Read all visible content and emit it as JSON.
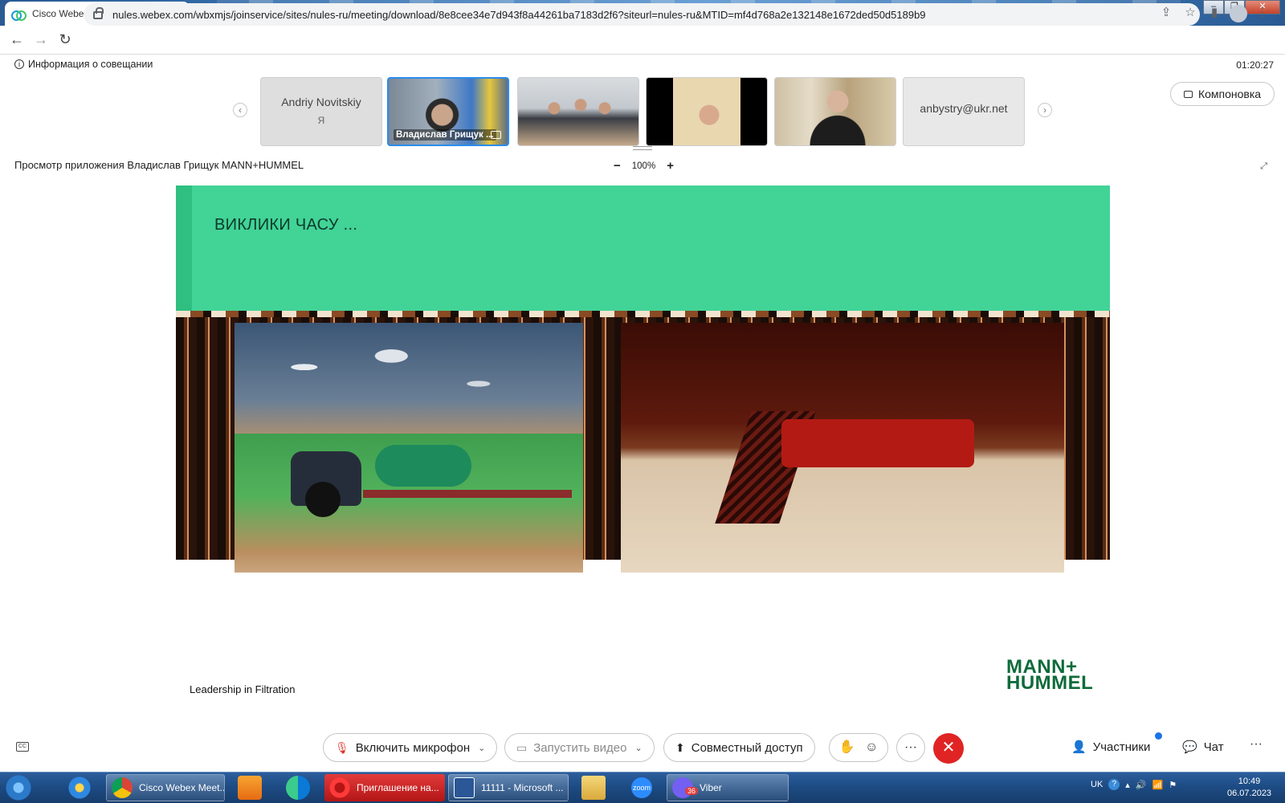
{
  "browser": {
    "tab_title": "Cisco Webex Meetings",
    "url": "nules.webex.com/wbxmjs/joinservice/sites/nules-ru/meeting/download/8e8cee34e7d943f8a44261ba7183d2f6?siteurl=nules-ru&MTID=mf4d768a2e132148e1672ded50d5189b9"
  },
  "meeting": {
    "info_label": "Информация о совещании",
    "timer": "01:20:27",
    "layout_label": "Компоновка",
    "viewing_label": "Просмотр приложения Владислав Грищук MANN+HUMMEL",
    "zoom_value": "100%",
    "participants": [
      {
        "name": "Andriy Novitskiy",
        "sub": "Я"
      },
      {
        "caption": "Владислав Грищук ..."
      },
      {
        "name": "anbystry@ukr.net"
      }
    ]
  },
  "slide": {
    "title": "ВИКЛИКИ ЧАСУ ...",
    "footer": "Leadership in Filtration",
    "logo_line1": "MANN+",
    "logo_line2": "HUMMEL"
  },
  "controls": {
    "mic": "Включить микрофон",
    "video": "Запустить видео",
    "share": "Совместный доступ",
    "participants": "Участники",
    "chat": "Чат"
  },
  "taskbar": {
    "items": [
      "Cisco Webex Meet...",
      "Приглашение на...",
      "11111 - Microsoft ...",
      "Viber"
    ],
    "zoom_label": "zoom",
    "viber_badge": "36",
    "language": "UK",
    "time": "10:49",
    "date": "06.07.2023"
  }
}
